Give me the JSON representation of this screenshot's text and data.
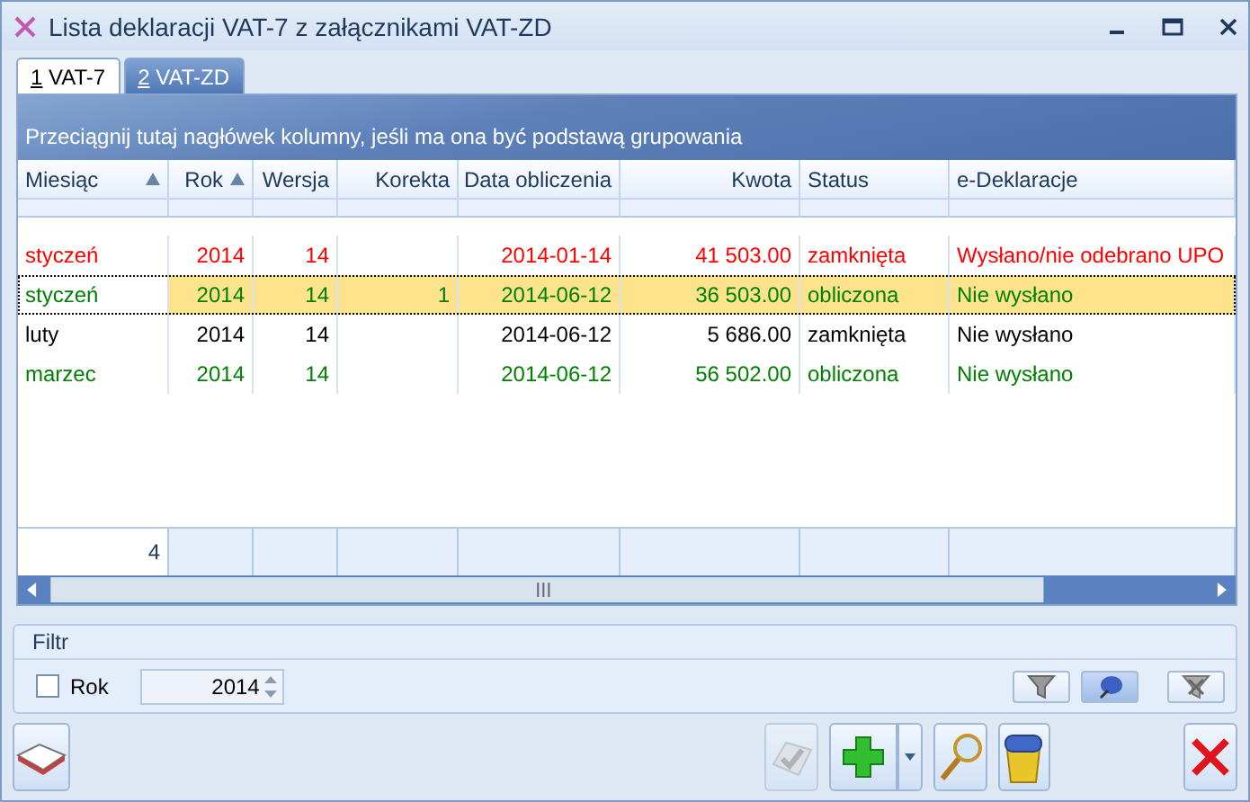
{
  "window": {
    "title": "Lista deklaracji VAT-7 z załącznikami VAT-ZD"
  },
  "tabs": [
    {
      "label": "1 VAT-7",
      "selected": true
    },
    {
      "label": "2 VAT-ZD",
      "selected": false
    }
  ],
  "group_hint": "Przeciągnij tutaj nagłówek kolumny, jeśli ma ona być podstawą grupowania",
  "table": {
    "columns": [
      {
        "label": "Miesiąc",
        "kind": "text",
        "sorted": true
      },
      {
        "label": "Rok",
        "kind": "number",
        "sorted": true
      },
      {
        "label": "Wersja",
        "kind": "number",
        "sorted": false
      },
      {
        "label": "Korekta",
        "kind": "number",
        "sorted": false
      },
      {
        "label": "Data obliczenia",
        "kind": "number",
        "sorted": false
      },
      {
        "label": "Kwota",
        "kind": "number",
        "sorted": false
      },
      {
        "label": "Status",
        "kind": "text",
        "sorted": false
      },
      {
        "label": "e-Deklaracje",
        "kind": "text",
        "sorted": false
      }
    ],
    "rows": [
      {
        "color": "#ff0000",
        "selected": false,
        "cells": [
          "styczeń",
          "2014",
          "14",
          "",
          "2014-01-14",
          "41 503.00",
          "zamknięta",
          "Wysłano/nie odebrano UPO"
        ]
      },
      {
        "color": "#008000",
        "selected": true,
        "cells": [
          "styczeń",
          "2014",
          "14",
          "1",
          "2014-06-12",
          "36 503.00",
          "obliczona",
          "Nie wysłano"
        ]
      },
      {
        "color": "#000000",
        "selected": false,
        "cells": [
          "luty",
          "2014",
          "14",
          "",
          "2014-06-12",
          "5 686.00",
          "zamknięta",
          "Nie wysłano"
        ]
      },
      {
        "color": "#008000",
        "selected": false,
        "cells": [
          "marzec",
          "2014",
          "14",
          "",
          "2014-06-12",
          "56 502.00",
          "obliczona",
          "Nie wysłano"
        ]
      }
    ],
    "footer": {
      "count": "4"
    }
  },
  "filter": {
    "title": "Filtr",
    "checkbox": {
      "label": "Rok",
      "checked": false
    },
    "spinner": {
      "value": "2014"
    },
    "toggles": [
      {
        "kind": "funnel",
        "selected": false
      },
      {
        "kind": "pin",
        "selected": true
      },
      {
        "kind": "clear",
        "selected": false
      }
    ]
  },
  "toolbar": [
    {
      "kind": "book",
      "disabled": false
    },
    {
      "kind": "check",
      "disabled": true
    },
    {
      "kind": "add",
      "disabled": false
    },
    {
      "kind": "search",
      "disabled": false
    },
    {
      "kind": "bin",
      "disabled": false
    },
    {
      "kind": "close",
      "disabled": false
    }
  ]
}
